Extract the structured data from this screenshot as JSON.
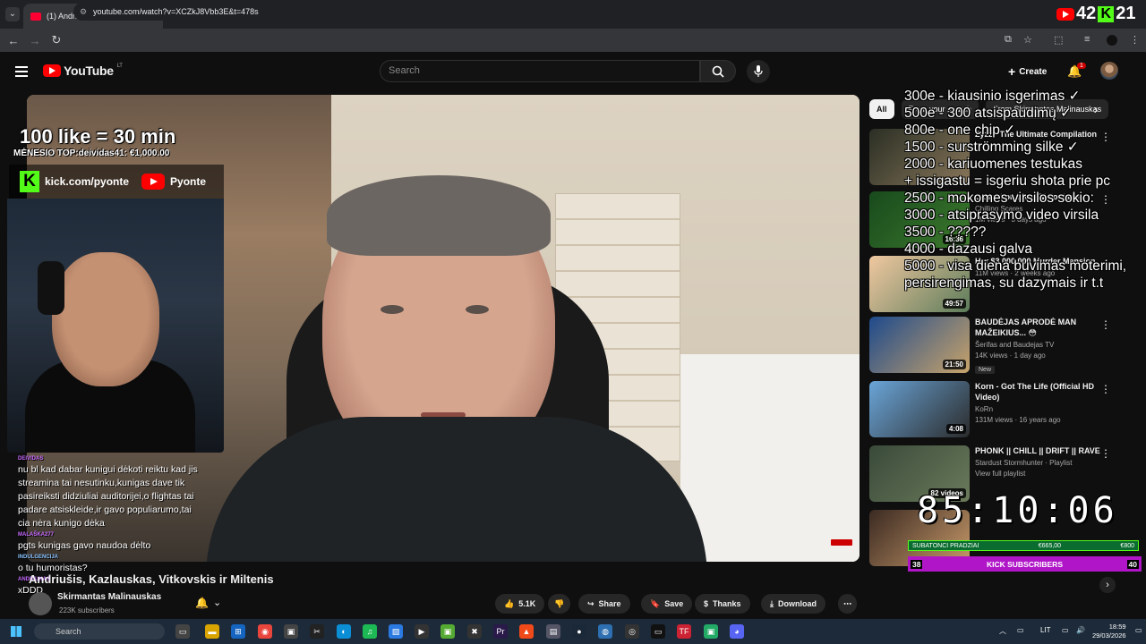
{
  "browser": {
    "tab_title": "(1) Andriušis, Kazlauskas, Vitkovs",
    "url": "youtube.com/watch?v=XCZkJ8Vbb3E&t=478s"
  },
  "counter": {
    "youtube_count": "42",
    "kick_count": "21"
  },
  "youtube": {
    "logo_text": "YouTube",
    "region_code": "LT",
    "search_placeholder": "Search",
    "create_label": "Create",
    "notifications": "1"
  },
  "stream_overlay": {
    "like_goal": "100 like = 30 min",
    "top_donator": "MĖNESIO TOP:deividas41: €1,000.00",
    "kick_handle": "kick.com/pyonte",
    "youtube_handle": "Pyonte",
    "chat": [
      {
        "user": "DEIVIDAS",
        "text": "nu bl kad dabar kunigui dėkoti reiktu kad jis streamina tai nesutinku,kunigas dave tik pasireiksti didziuliai auditorijei,o flightas tai padare atsiskleide,ir gavo populiarumo,tai cia nėra kunigo dėka"
      },
      {
        "user": "MALAŠKA277",
        "text": "pgts kunigas gavo naudoa dėlto"
      },
      {
        "user": "INDULGENCIJA",
        "text": "o tu humoristas?"
      },
      {
        "user": "ANDRIUKAS",
        "text": "xDDD"
      }
    ],
    "goals": [
      "300e - kiausinio isgerimas ✓",
      "500e - 300 atsispaudimų ✓",
      "800e - one chip ✓",
      "1500 - surströmming silke ✓",
      "2000 - kariuomenes testukas",
      "+ issigastu = isgeriu shota prie pc",
      "2500 - mokomes virsilos sokio:",
      "3000 - atsiprasymo video virsila",
      "3500 - ?????",
      "4000 - dazausi galva",
      "5000 - visa diena buvimas moterimi,",
      "persirengimas, su dazymais ir t.t"
    ],
    "timer": "85:10:06",
    "sub_bar": {
      "left": "SUBATONCI PRADZIAI",
      "middle": "€665,00",
      "right": "€800"
    },
    "kick_bar": {
      "current": "38",
      "label": "KICK SUBSCRIBERS",
      "goal": "40"
    }
  },
  "video": {
    "title": "Andriušis, Kazlauskas, Vitkovskis ir Miltenis",
    "channel": "Skirmantas Malinauskas",
    "subscribers": "223K subscribers",
    "likes": "5.1K",
    "share_label": "Share",
    "save_label": "Save",
    "thanks_label": "Thanks",
    "download_label": "Download"
  },
  "chips": [
    "All",
    "From your search",
    "From Skirmantas Malinauskas"
  ],
  "recommendations": [
    {
      "title": "Zyzz - The Ultimate Compilation",
      "channel": "",
      "meta": "",
      "duration": "",
      "colors": [
        "#2a2f24",
        "#88765a"
      ]
    },
    {
      "title": "Caught on Live TV Footage",
      "channel": "Chilling Scares",
      "meta": "1M views · 3 days ago",
      "duration": "16:36",
      "colors": [
        "#184a1c",
        "#3d7a2e"
      ]
    },
    {
      "title": "Her $3,000,000 Murder Mansion",
      "channel": "",
      "meta": "11M views · 2 weeks ago",
      "duration": "49:57",
      "colors": [
        "#f0c8a0",
        "#5c7c5a"
      ]
    },
    {
      "title": "BAUDĖJAS APRODĖ MAN MAŽEIKIUS... 😳",
      "channel": "Šerifas and Baudejas TV",
      "meta": "14K views · 1 day ago",
      "badge": "New",
      "duration": "21:50",
      "colors": [
        "#1e4a8c",
        "#c8a36a"
      ]
    },
    {
      "title": "Korn - Got The Life (Official HD Video)",
      "channel": "KoRn",
      "meta": "131M views · 16 years ago",
      "duration": "4:08",
      "colors": [
        "#6aa5d8",
        "#2b2b2b"
      ]
    },
    {
      "title": "PHONK || CHILL || DRIFT || RAVE",
      "channel": "Stardust Stormhunter · Playlist",
      "meta": "View full playlist",
      "duration": "82 videos",
      "colors": [
        "#3a4a3a",
        "#6a7a5a"
      ]
    },
    {
      "title": "",
      "channel": "",
      "meta": "",
      "duration": "",
      "colors": [
        "#3b2a22",
        "#c89a6a"
      ]
    }
  ],
  "taskbar": {
    "search_placeholder": "Search",
    "language": "LIT",
    "time": "18:59",
    "date": "29/03/2026"
  }
}
